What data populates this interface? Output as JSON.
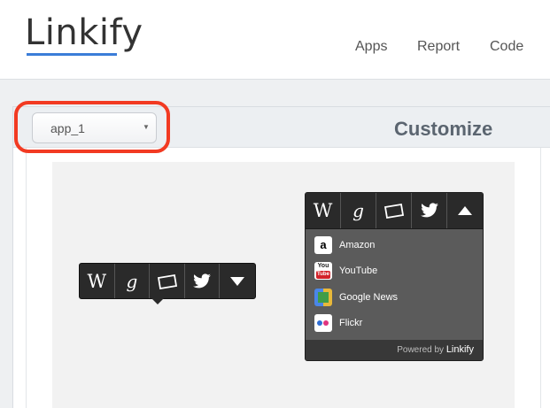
{
  "header": {
    "logo": "Linkify",
    "nav": [
      "Apps",
      "Report",
      "Code"
    ]
  },
  "toolbar": {
    "selected_app": "app_1",
    "title": "Customize"
  },
  "preview": {
    "small_bar": {
      "buttons": [
        {
          "icon": "wikipedia-icon",
          "glyph": "W"
        },
        {
          "icon": "google-icon",
          "glyph": "g"
        },
        {
          "icon": "photos-icon"
        },
        {
          "icon": "twitter-icon"
        },
        {
          "icon": "caret-down-icon"
        }
      ]
    },
    "big_bar": {
      "buttons": [
        {
          "icon": "wikipedia-icon",
          "glyph": "W"
        },
        {
          "icon": "google-icon",
          "glyph": "g"
        },
        {
          "icon": "photos-icon"
        },
        {
          "icon": "twitter-icon"
        },
        {
          "icon": "caret-up-icon"
        }
      ],
      "links": [
        {
          "label": "Amazon",
          "icon": "amazon-icon"
        },
        {
          "label": "YouTube",
          "icon": "youtube-icon"
        },
        {
          "label": "Google News",
          "icon": "google-news-icon"
        },
        {
          "label": "Flickr",
          "icon": "flickr-icon"
        }
      ],
      "footer_prefix": "Powered by",
      "footer_brand": "Linkify"
    }
  },
  "colors": {
    "accent": "#3b7dd8",
    "highlight": "#f23a22",
    "toolbar_bg": "#2a2a2a",
    "panel_bg": "#5b5b5b"
  }
}
